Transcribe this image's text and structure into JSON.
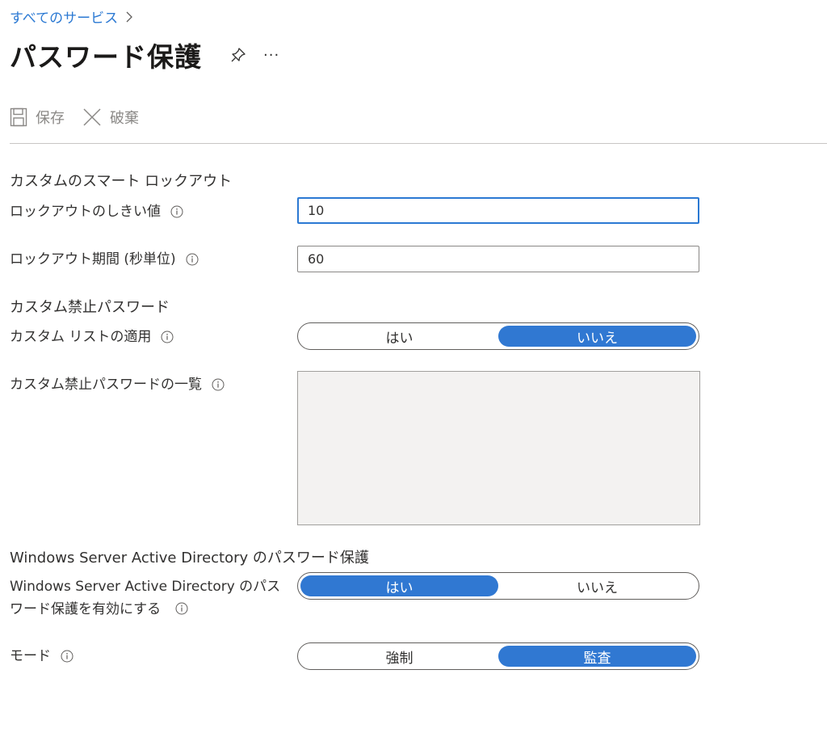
{
  "breadcrumb": {
    "link": "すべてのサービス",
    "separator_icon": "chevron-right-icon"
  },
  "header": {
    "title": "パスワード保護",
    "pin_icon": "pin-icon",
    "more_label": "···"
  },
  "toolbar": {
    "save_label": "保存",
    "discard_label": "破棄"
  },
  "lockout": {
    "heading": "カスタムのスマート ロックアウト",
    "threshold_label": "ロックアウトのしきい値",
    "threshold_value": "10",
    "duration_label": "ロックアウト期間 (秒単位)",
    "duration_value": "60"
  },
  "banned": {
    "heading": "カスタム禁止パスワード",
    "enforce_label": "カスタム リストの適用",
    "enforce_options": [
      "はい",
      "いいえ"
    ],
    "enforce_selected": "いいえ",
    "list_label": "カスタム禁止パスワードの一覧",
    "list_value": ""
  },
  "ad": {
    "heading": "Windows Server Active Directory のパスワード保護",
    "enable_label": "Windows Server Active Directory のパスワード保護を有効にする",
    "enable_options": [
      "はい",
      "いいえ"
    ],
    "enable_selected": "はい",
    "mode_label": "モード",
    "mode_options": [
      "強制",
      "監査"
    ],
    "mode_selected": "監査"
  },
  "colors": {
    "accent": "#3078d2",
    "link": "#2b79d3",
    "text": "#323130",
    "disabled": "#8a8886"
  }
}
